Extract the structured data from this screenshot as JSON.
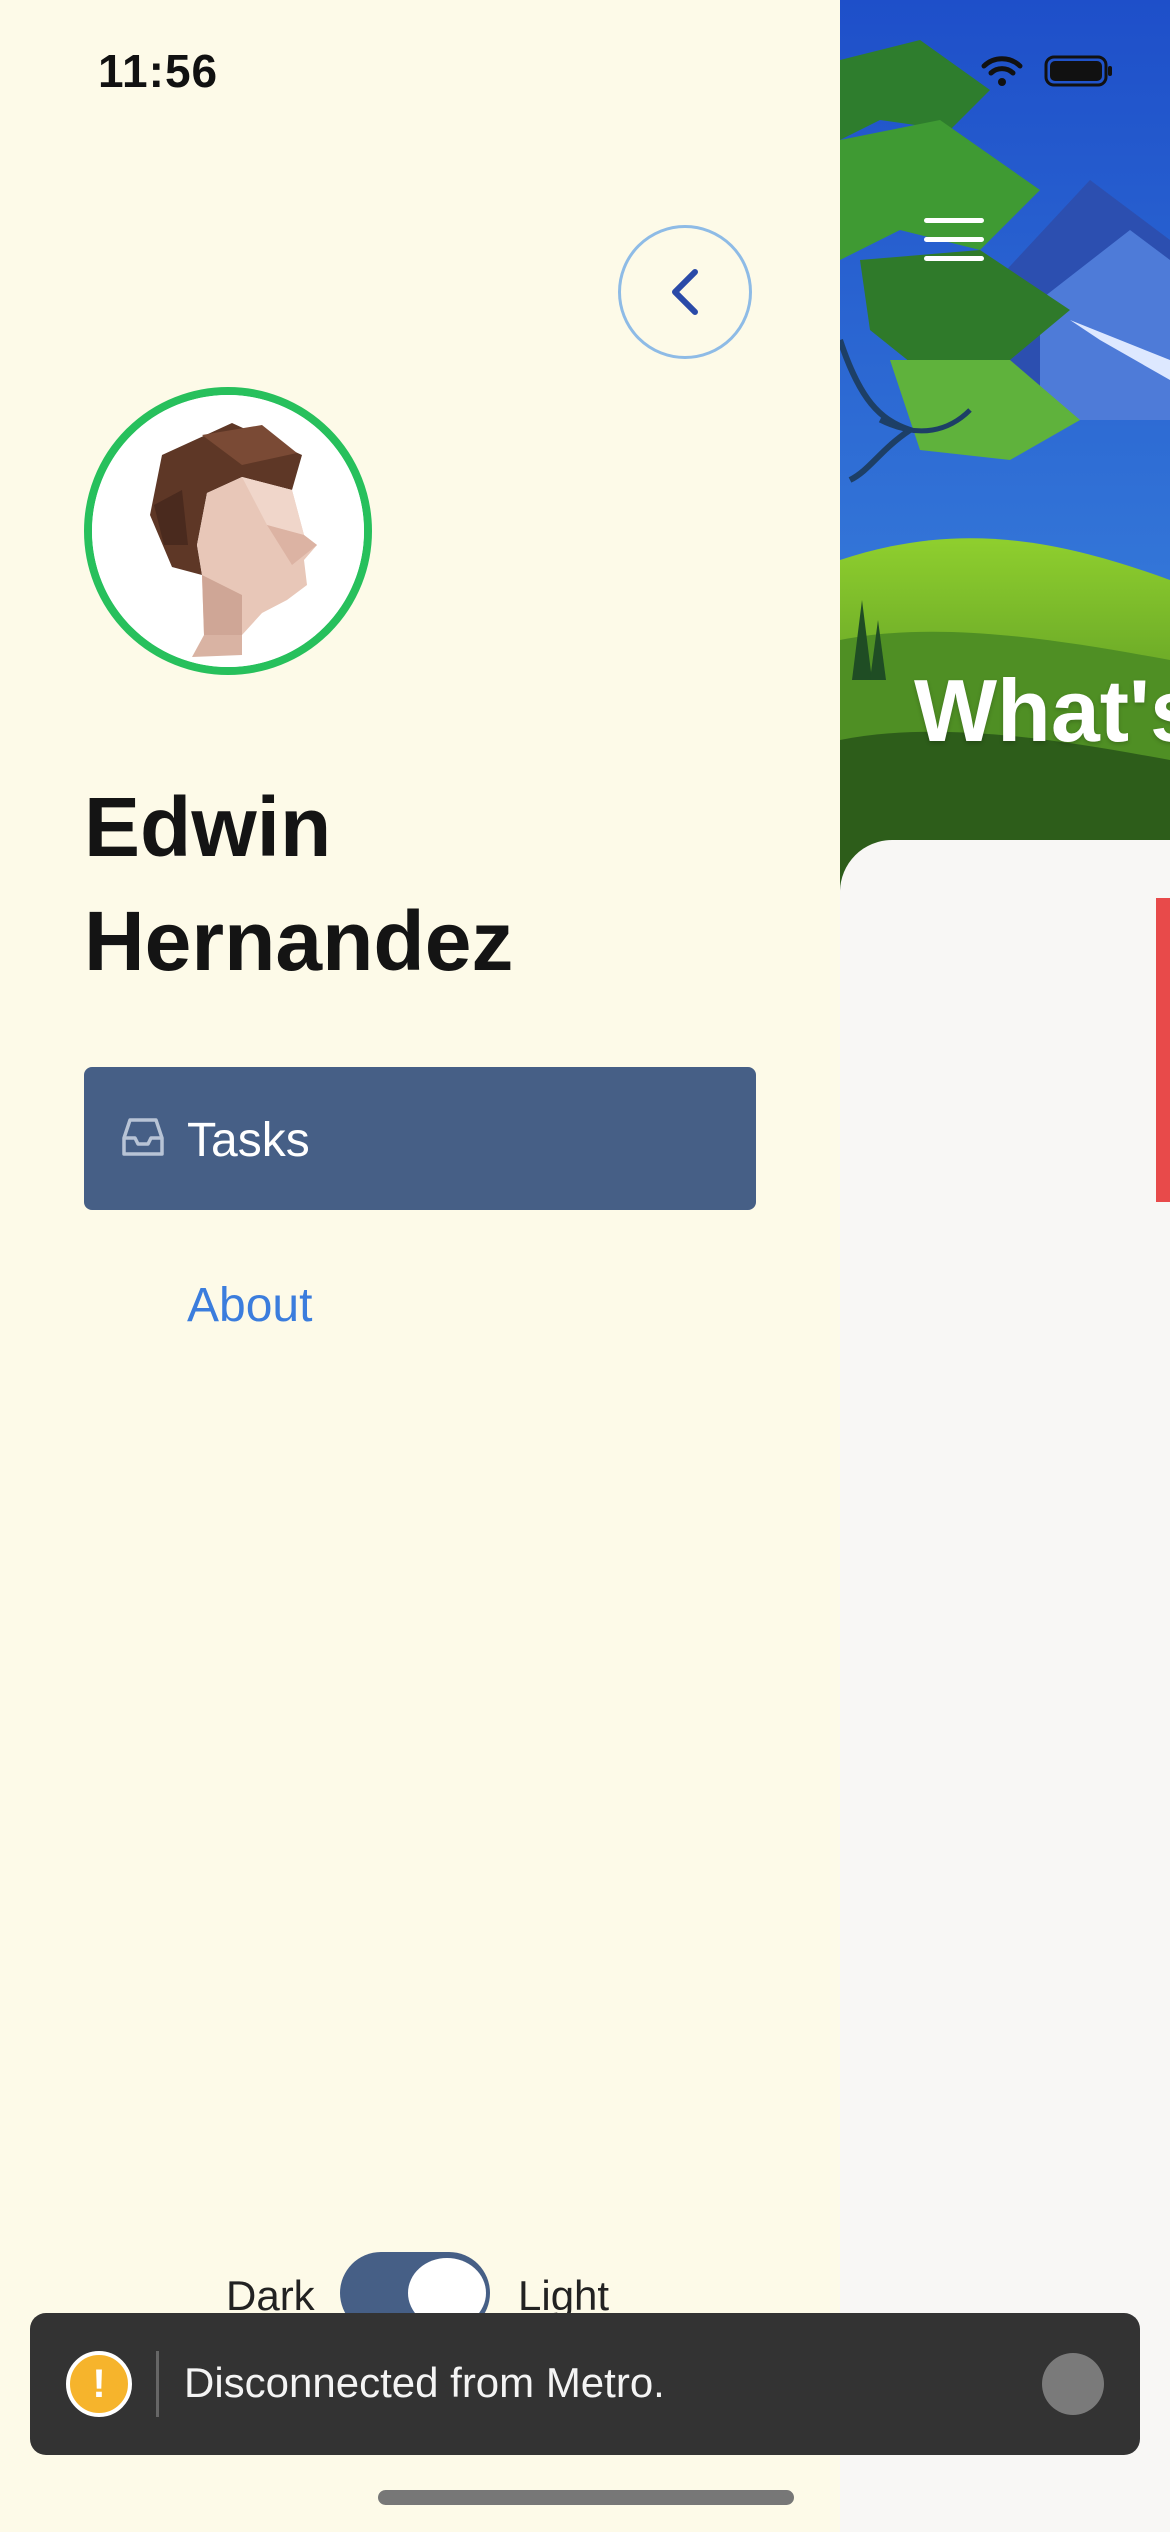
{
  "status_bar": {
    "time": "11:56"
  },
  "drawer": {
    "user_name_line1": "Edwin",
    "user_name_line2": "Hernandez",
    "items": [
      {
        "label": "Tasks",
        "active": true,
        "icon": "inbox-icon"
      },
      {
        "label": "About",
        "active": false
      }
    ],
    "theme_toggle": {
      "left_label": "Dark",
      "right_label": "Light",
      "value": "Light"
    }
  },
  "main": {
    "hero_heading": "What's"
  },
  "toast": {
    "message": "Disconnected from Metro."
  },
  "colors": {
    "drawer_bg": "#fdfae8",
    "active_item_bg": "#465f86",
    "link": "#3b7ddd",
    "avatar_ring": "#27c05c",
    "warning": "#f6b42c",
    "toast_bg": "#333333"
  }
}
